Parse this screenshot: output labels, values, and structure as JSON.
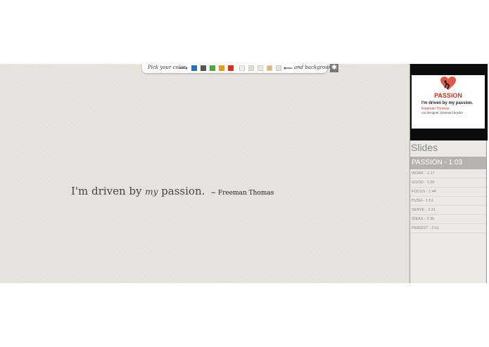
{
  "quote": {
    "text_before": "I'm driven by ",
    "text_my": "my",
    "text_after": " passion.",
    "author": "~ Freeman Thomas"
  },
  "toolbar": {
    "pick_color_label": "Pick your color",
    "and_background_label": "and background",
    "colors": [
      "#2b6fb6",
      "#555555",
      "#4aab3a",
      "#e89a1c",
      "#d9321f"
    ],
    "backgrounds": [
      "#f1efeb",
      "#dedad3",
      "#ebe8e1",
      "#e3b873",
      "#e6e3dd"
    ],
    "settings_icon": "gear-icon"
  },
  "sidebar": {
    "thumbnail": {
      "title": "PASSION",
      "line1": "I'm driven by my passion.",
      "line2": "Freeman Thomas",
      "line3": "car designer, DaimlerChrysler"
    },
    "slides_heading": "Slides",
    "active_slide": "PASSION - 1:03",
    "slides": [
      "WORK - 1:17",
      "GOOD - 1:36",
      "FOCUS - 1:44",
      "PUSH - 1:51",
      "SERVE - 2:21",
      "IDEAS - 2:35",
      "PERSIST - 2:51"
    ]
  }
}
